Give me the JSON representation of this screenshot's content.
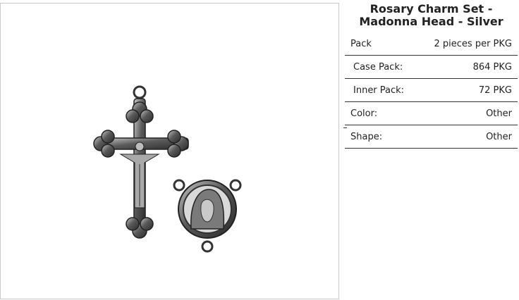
{
  "product": {
    "title": "Rosary Charm Set - Madonna Head - Silver",
    "image_alt": "Silver crucifix and Madonna head rosary center charms"
  },
  "specs": [
    {
      "label": "Pack",
      "value": "2 pieces per PKG"
    },
    {
      "label": "Case Pack:",
      "value": "864 PKG"
    },
    {
      "label": "Inner Pack:",
      "value": "72 PKG"
    },
    {
      "label": "Color:",
      "value": "Other"
    },
    {
      "label": "Shape:",
      "value": "Other"
    }
  ],
  "colors": {
    "silver_dark": "#2a2a2a",
    "silver_mid": "#6d6d6d",
    "silver_light": "#bdbdbd",
    "border": "#c9c9c9",
    "rule": "#333333"
  }
}
